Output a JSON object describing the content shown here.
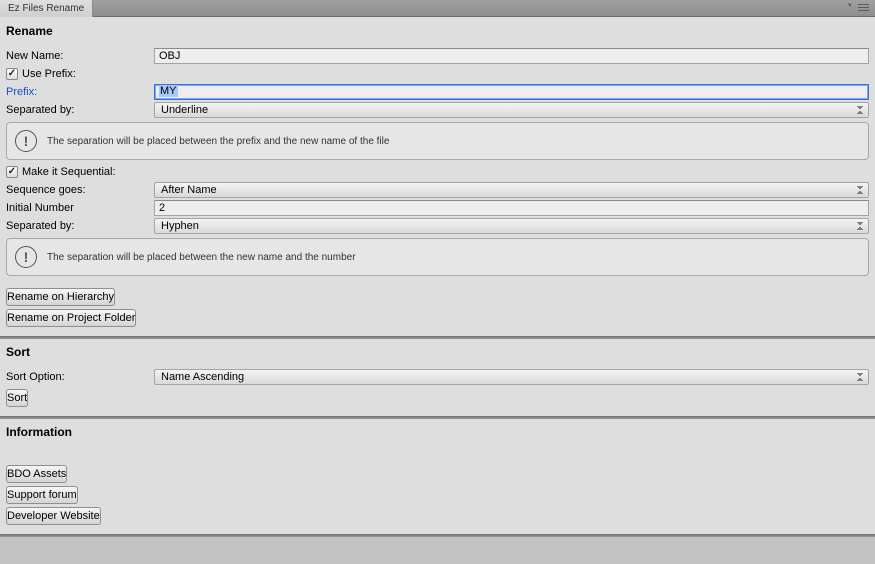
{
  "window": {
    "tab_title": "Ez Files Rename"
  },
  "rename": {
    "header": "Rename",
    "new_name_label": "New Name:",
    "new_name_value": "OBJ",
    "use_prefix_label": "Use Prefix:",
    "use_prefix_checked": true,
    "prefix_label": "Prefix:",
    "prefix_value": "MY",
    "sep1_label": "Separated by:",
    "sep1_value": "Underline",
    "help1": "The separation will be placed between the prefix and the new name of the file",
    "make_seq_label": "Make it Sequential:",
    "make_seq_checked": true,
    "seq_goes_label": "Sequence goes:",
    "seq_goes_value": "After Name",
    "init_num_label": "Initial Number",
    "init_num_value": "2",
    "sep2_label": "Separated by:",
    "sep2_value": "Hyphen",
    "help2": "The separation will be placed between the new name and the number",
    "btn_hierarchy": "Rename on Hierarchy",
    "btn_project": "Rename on Project Folder"
  },
  "sort": {
    "header": "Sort",
    "option_label": "Sort Option:",
    "option_value": "Name Ascending",
    "btn_sort": "Sort"
  },
  "info": {
    "header": "Information",
    "btn_assets": "BDO Assets",
    "btn_forum": "Support forum",
    "btn_site": "Developer Website"
  }
}
